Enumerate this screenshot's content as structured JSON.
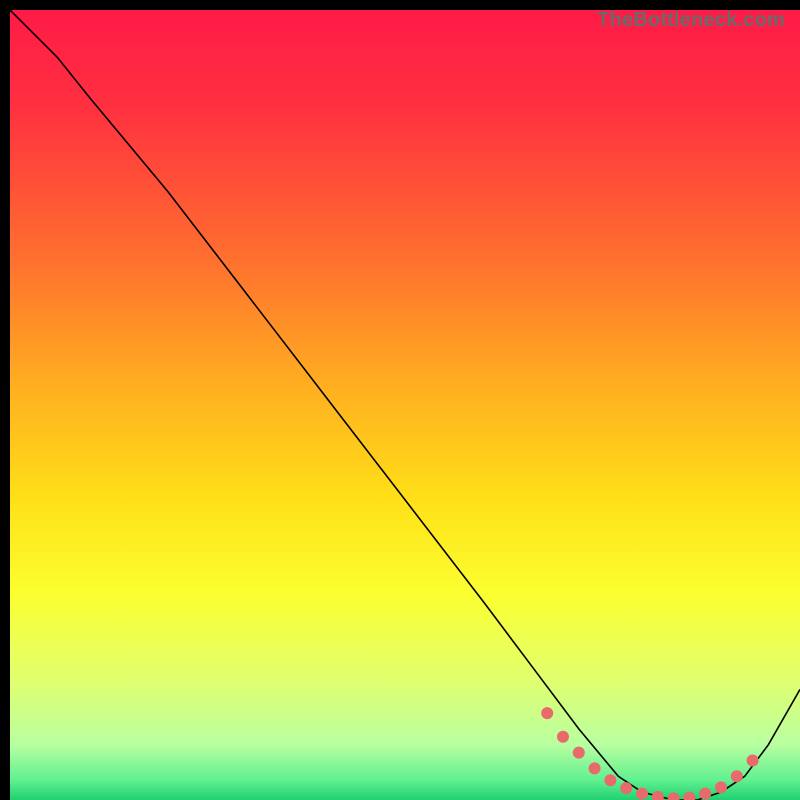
{
  "watermark": "TheBottleneck.com",
  "chart_data": {
    "type": "line",
    "title": "",
    "xlabel": "",
    "ylabel": "",
    "xlim": [
      0,
      100
    ],
    "ylim": [
      0,
      100
    ],
    "background_gradient": {
      "stops": [
        {
          "offset": 0.0,
          "color": "#ff1a47"
        },
        {
          "offset": 0.12,
          "color": "#ff3040"
        },
        {
          "offset": 0.3,
          "color": "#ff6a30"
        },
        {
          "offset": 0.48,
          "color": "#ffb020"
        },
        {
          "offset": 0.62,
          "color": "#ffe018"
        },
        {
          "offset": 0.74,
          "color": "#fbff30"
        },
        {
          "offset": 0.85,
          "color": "#e0ff70"
        },
        {
          "offset": 0.93,
          "color": "#b8ffa0"
        },
        {
          "offset": 0.975,
          "color": "#60f090"
        },
        {
          "offset": 1.0,
          "color": "#20d070"
        }
      ]
    },
    "series": [
      {
        "name": "bottleneck-curve",
        "color": "#000000",
        "stroke_width": 1.6,
        "x": [
          0,
          6,
          10,
          20,
          30,
          40,
          50,
          60,
          66,
          72,
          77,
          80,
          84,
          87,
          90,
          93,
          96,
          100
        ],
        "y": [
          100,
          94,
          89,
          77,
          64,
          51,
          38,
          25,
          17,
          9,
          3,
          1,
          0,
          0,
          1,
          3,
          7,
          14
        ]
      }
    ],
    "markers": {
      "name": "optimal-zone-markers",
      "color": "#e86a6a",
      "radius": 6,
      "points": [
        {
          "x": 68,
          "y": 11
        },
        {
          "x": 70,
          "y": 8
        },
        {
          "x": 72,
          "y": 6
        },
        {
          "x": 74,
          "y": 4
        },
        {
          "x": 76,
          "y": 2.5
        },
        {
          "x": 78,
          "y": 1.5
        },
        {
          "x": 80,
          "y": 0.8
        },
        {
          "x": 82,
          "y": 0.4
        },
        {
          "x": 84,
          "y": 0.2
        },
        {
          "x": 86,
          "y": 0.3
        },
        {
          "x": 88,
          "y": 0.8
        },
        {
          "x": 90,
          "y": 1.6
        },
        {
          "x": 92,
          "y": 3.0
        },
        {
          "x": 94,
          "y": 5.0
        }
      ]
    }
  }
}
